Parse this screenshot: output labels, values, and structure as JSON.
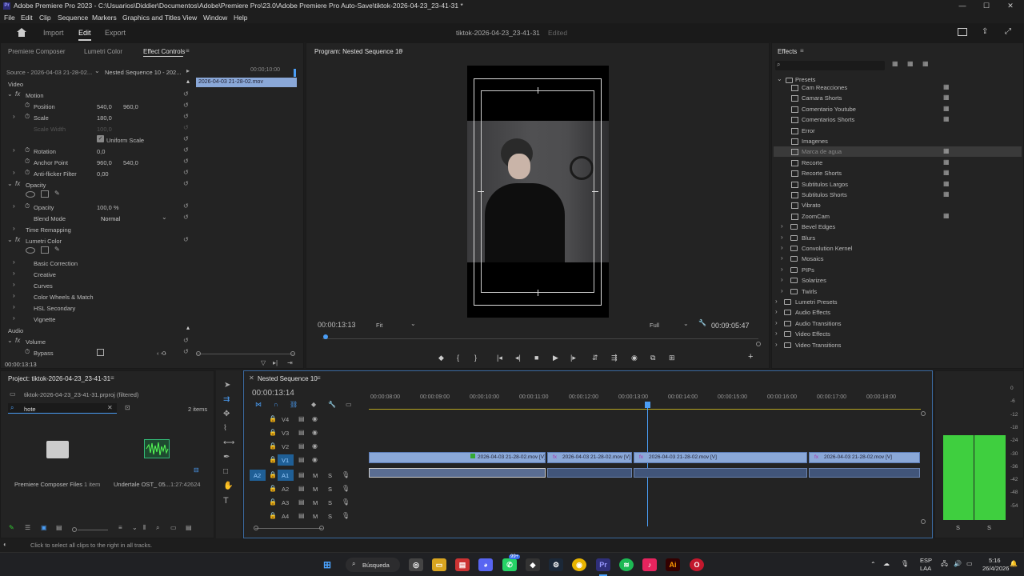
{
  "window": {
    "title": "Adobe Premiere Pro 2023 - C:\\Usuarios\\Diddier\\Documentos\\Adobe\\Premiere Pro\\23.0\\Adobe Premiere Pro Auto-Save\\tiktok-2026-04-23_23-41-31 *",
    "min": "—",
    "max": "☐",
    "close": "✕",
    "app_abbr": "Pr"
  },
  "menu": [
    "File",
    "Edit",
    "Clip",
    "Sequence",
    "Markers",
    "Graphics and Titles",
    "View",
    "Window",
    "Help"
  ],
  "header": {
    "import": "Import",
    "edit": "Edit",
    "export": "Export",
    "project_name": "tiktok-2026-04-23_23-41-31",
    "status": "Edited"
  },
  "effect_controls": {
    "tabs": [
      "Premiere Composer",
      "Lumetri Color",
      "Effect Controls"
    ],
    "source": "Source - 2026-04-03 21-28-02...",
    "sequence": "Nested Sequence 10 - 202...",
    "timecode_top": "00:00;10:00",
    "clip_name": "2026-04-03 21-28-02.mov",
    "video": "Video",
    "motion": "Motion",
    "position_label": "Position",
    "position_x": "540,0",
    "position_y": "960,0",
    "scale_label": "Scale",
    "scale_value": "180,0",
    "scale_width_label": "Scale Width",
    "scale_width_value": "100,0",
    "uniform_scale": "Uniform Scale",
    "rotation_label": "Rotation",
    "rotation_value": "0,0",
    "anchor_label": "Anchor Point",
    "anchor_x": "960,0",
    "anchor_y": "540,0",
    "antiflicker_label": "Anti-flicker Filter",
    "antiflicker_value": "0,00",
    "opacity_section": "Opacity",
    "opacity_label": "Opacity",
    "opacity_value": "100,0 %",
    "blend_label": "Blend Mode",
    "blend_value": "Normal",
    "time_remap": "Time Remapping",
    "lumetri": "Lumetri Color",
    "lumetri_items": [
      "Basic Correction",
      "Creative",
      "Curves",
      "Color Wheels & Match",
      "HSL Secondary",
      "Vignette"
    ],
    "audio": "Audio",
    "volume": "Volume",
    "bypass": "Bypass",
    "bypass_value": "0",
    "timecode_bottom": "00:00:13:13"
  },
  "program": {
    "title": "Program: Nested Sequence 10",
    "timecode": "00:00:13:13",
    "fit": "Fit",
    "quality": "Full",
    "duration": "00:09:05:47"
  },
  "effects": {
    "title": "Effects",
    "presets": "Presets",
    "preset_items": [
      "Cam Reacciones",
      "Camara Shorts",
      "Comentario Youtube",
      "Comentarios Shorts",
      "Error",
      "Imagenes",
      "Marca de agua",
      "Recorte",
      "Recorte Shorts",
      "Subtitulos Largos",
      "Subtitulos Shorts",
      "Vibrato",
      "ZoomCam"
    ],
    "folders": [
      "Bevel Edges",
      "Blurs",
      "Convolution Kernel",
      "Mosaics",
      "PIPs",
      "Solarizes",
      "Twirls"
    ],
    "top_folders": [
      "Lumetri Presets",
      "Audio Effects",
      "Audio Transitions",
      "Video Effects",
      "Video Transitions"
    ]
  },
  "project": {
    "title": "Project: tiktok-2026-04-23_23-41-31",
    "file": "tiktok-2026-04-23_23-41-31.prproj (filtered)",
    "search": "hote",
    "count": "2 items",
    "item1_name": "Premiere Composer Files",
    "item1_meta": "1 item",
    "item2_name": "Undertale OST_ 05...",
    "item2_meta": "1:27:42624"
  },
  "timeline": {
    "title": "Nested Sequence 10",
    "timecode": "00:00:13:14",
    "ticks": [
      "00:00:08:00",
      "00:00:09:00",
      "00:00:10:00",
      "00:00:11:00",
      "00:00:12:00",
      "00:00:13:00",
      "00:00:14:00",
      "00:00:15:00",
      "00:00:16:00",
      "00:00:17:00",
      "00:00:18:00"
    ],
    "video_tracks": [
      "V4",
      "V3",
      "V2",
      "V1"
    ],
    "audio_tracks": [
      "A1",
      "A2",
      "A3",
      "A4"
    ],
    "a2_label": "A2",
    "m": "M",
    "s": "S",
    "clips": [
      "2026-04-03 21-28-02.mov [V]",
      "2026-04-03 21-28-02.mov [V]",
      "2026-04-03 21-28-02.mov [V]",
      "2026-04-03 21-28-02.mov [V]"
    ]
  },
  "meter": {
    "labels": [
      "0",
      "-6",
      "-12",
      "-18",
      "-24",
      "-30",
      "-36",
      "-42",
      "-48",
      "-54"
    ],
    "s1": "S",
    "s2": "S"
  },
  "status": "Click to select all clips to the right in all tracks.",
  "taskbar": {
    "search": "Búsqueda",
    "lang1": "ESP",
    "lang2": "LAA",
    "time": "5:16",
    "date": "26/4/2026",
    "badge": "99+"
  },
  "colors": {
    "accent": "#4a9df5",
    "clip": "#8aa8d8",
    "meter": "#3fcf3f"
  }
}
